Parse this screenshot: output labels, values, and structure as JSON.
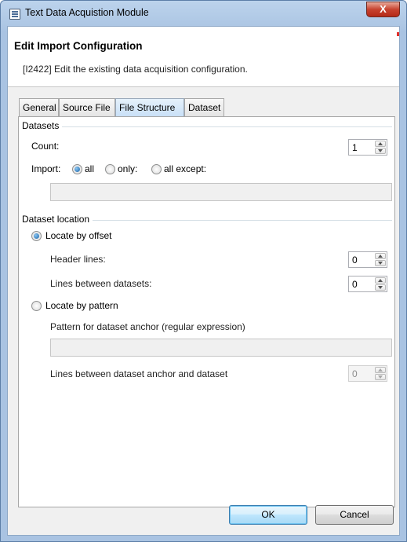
{
  "window": {
    "title": "Text Data Acquistion Module",
    "close_label": "X"
  },
  "header": {
    "title": "Edit Import Configuration",
    "description": "[I2422] Edit the existing data acquisition configuration."
  },
  "tabs": [
    {
      "label": "General"
    },
    {
      "label": "Source File"
    },
    {
      "label": "File Structure",
      "active": true
    },
    {
      "label": "Dataset"
    }
  ],
  "datasets": {
    "group_label": "Datasets",
    "count_label": "Count:",
    "count_value": "1",
    "import_label": "Import:",
    "options": {
      "all": "all",
      "only": "only:",
      "all_except": "all except:"
    },
    "selected": "all"
  },
  "location": {
    "group_label": "Dataset location",
    "offset": {
      "label": "Locate by offset",
      "header_lines_label": "Header lines:",
      "header_lines_value": "0",
      "lines_between_label": "Lines between datasets:",
      "lines_between_value": "0"
    },
    "pattern": {
      "label": "Locate by pattern",
      "anchor_label": "Pattern for dataset anchor (regular expression)",
      "anchor_lines_label": "Lines between dataset anchor and dataset",
      "anchor_lines_value": "0"
    },
    "selected": "offset"
  },
  "buttons": {
    "ok": "OK",
    "cancel": "Cancel"
  },
  "colors": {
    "titlebar": "#a9c3e2",
    "accent": "#1a63a8",
    "close": "#c7432f"
  }
}
